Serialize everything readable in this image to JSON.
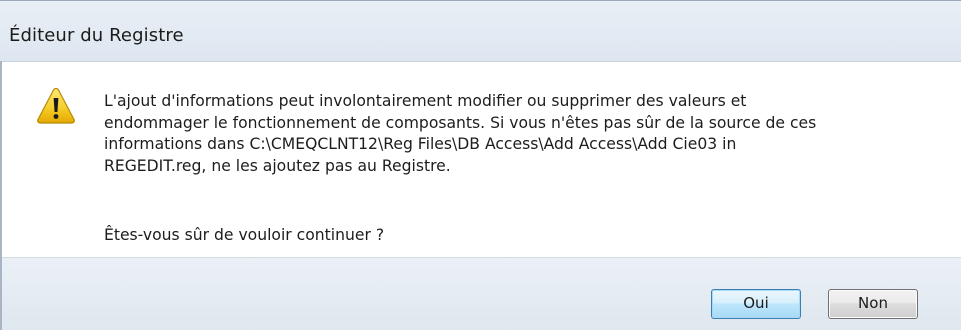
{
  "window": {
    "title": "Éditeur du Registre"
  },
  "message": {
    "line1": "L'ajout d'informations peut involontairement modifier ou supprimer des valeurs et",
    "line2": "endommager le fonctionnement de composants. Si vous n'êtes pas sûr de la source de ces",
    "line3": "informations dans C:\\CMEQCLNT12\\Reg Files\\DB Access\\Add Access\\Add Cie03 in",
    "line4": "REGEDIT.reg, ne les ajoutez pas au Registre.",
    "question": "Êtes-vous sûr de vouloir continuer ?"
  },
  "icon": {
    "name": "warning-icon",
    "color": "#f2c200"
  },
  "buttons": {
    "yes_label": "Oui",
    "no_label": "Non"
  }
}
